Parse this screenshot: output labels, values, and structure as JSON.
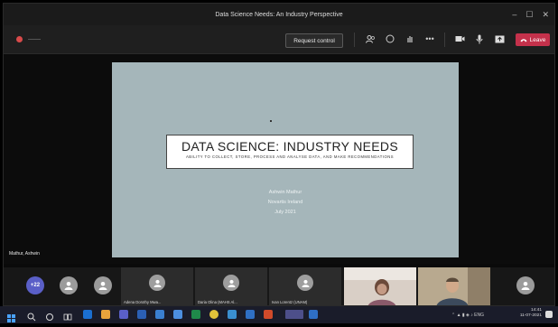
{
  "window": {
    "title": "Data Science Needs: An Industry Perspective",
    "controls": [
      "–",
      "☐",
      "✕"
    ]
  },
  "toolbar": {
    "request_control_label": "Request control",
    "leave_label": "Leave",
    "icons": [
      "people-icon",
      "chat-icon",
      "raise-hand-icon",
      "more-icon",
      "camera-icon",
      "mic-icon",
      "share-icon"
    ]
  },
  "slide": {
    "title": "DATA SCIENCE: INDUSTRY NEEDS",
    "subtitle": "ABILITY TO COLLECT, STORE, PROCESS AND ANALYSE DATA, AND MAKE RECOMMENDATIONS",
    "author": "Ashwin Mathur",
    "org": "Novartis Ireland",
    "date": "July 2021"
  },
  "presenter_name": "Mathur, Ashwin",
  "participants": {
    "more_count": "+22",
    "tiles": [
      {
        "label": "Adena Dorothy Mwa..."
      },
      {
        "label": "Daria Olina (MAHS Al..."
      },
      {
        "label": "Ivan Lorentz (UNAM)"
      }
    ]
  },
  "taskbar": {
    "time": "14:41",
    "date": "11-07-2021"
  },
  "colors": {
    "leave": "#c4314b",
    "slide_bg": "#a5b6ba",
    "accent": "#5a5fc7"
  }
}
